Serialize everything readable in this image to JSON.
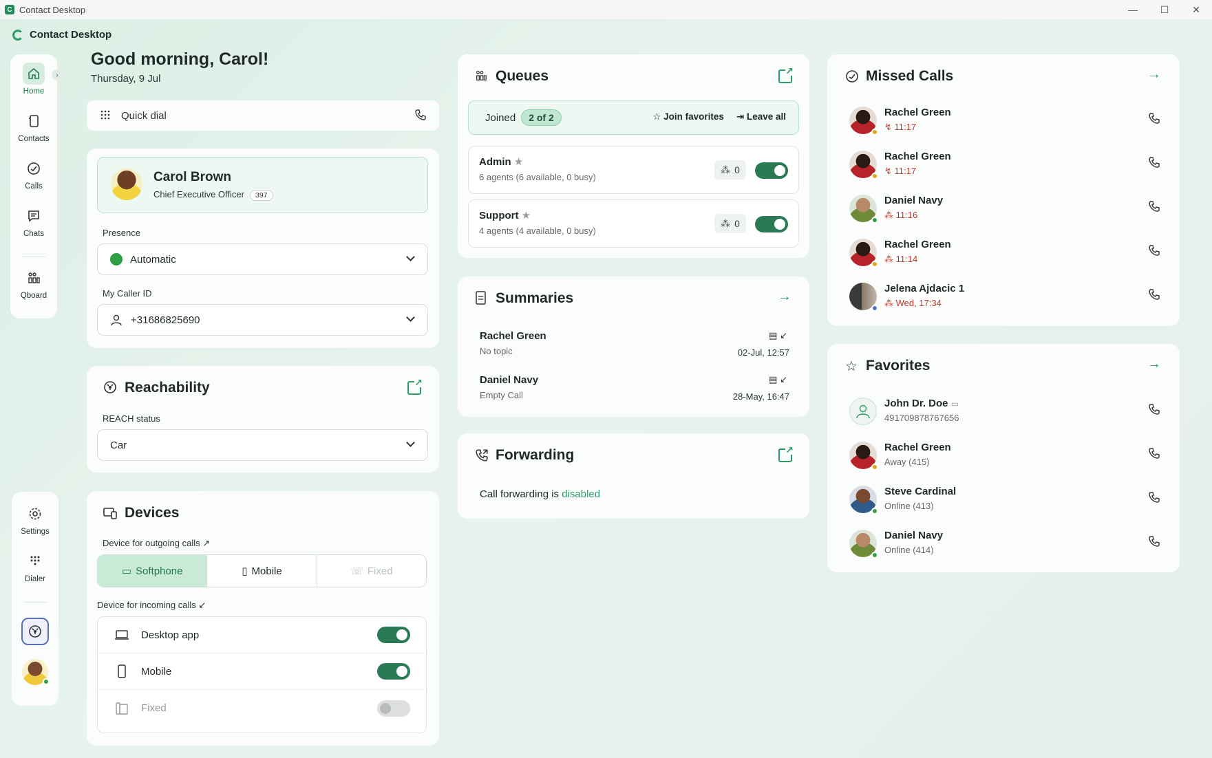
{
  "window": {
    "title": "Contact Desktop"
  },
  "app": {
    "name": "Contact Desktop"
  },
  "nav": {
    "items": [
      {
        "label": "Home",
        "icon": "home-icon",
        "active": true
      },
      {
        "label": "Contacts",
        "icon": "contacts-icon"
      },
      {
        "label": "Calls",
        "icon": "calls-icon"
      },
      {
        "label": "Chats",
        "icon": "chats-icon"
      },
      {
        "label": "Qboard",
        "icon": "qboard-icon"
      }
    ],
    "bottom": [
      {
        "label": "Settings",
        "icon": "gear-icon"
      },
      {
        "label": "Dialer",
        "icon": "dialpad-icon"
      }
    ]
  },
  "greeting": {
    "title": "Good morning, Carol!",
    "date": "Thursday, 9 Jul"
  },
  "quickdial": {
    "placeholder": "Quick dial"
  },
  "profile": {
    "name": "Carol Brown",
    "role": "Chief Executive Officer",
    "extension": "397",
    "presence_label": "Presence",
    "presence_value": "Automatic",
    "callerid_label": "My Caller ID",
    "callerid_value": "+31686825690"
  },
  "reachability": {
    "title": "Reachability",
    "status_label": "REACH status",
    "status_value": "Car"
  },
  "devices": {
    "title": "Devices",
    "outgoing_label": "Device for outgoing calls ↗",
    "outgoing_options": [
      "Softphone",
      "Mobile",
      "Fixed"
    ],
    "incoming_label": "Device for incoming calls ↙",
    "incoming": [
      {
        "label": "Desktop app",
        "enabled": true
      },
      {
        "label": "Mobile",
        "enabled": true
      },
      {
        "label": "Fixed",
        "enabled": false
      }
    ]
  },
  "queues": {
    "title": "Queues",
    "joined_label": "Joined",
    "joined_count": "2 of 2",
    "join_favorites": "Join favorites",
    "leave_all": "Leave all",
    "items": [
      {
        "name": "Admin",
        "sub": "6 agents (6 available, 0 busy)",
        "count": "0",
        "enabled": true
      },
      {
        "name": "Support",
        "sub": "4 agents (4 available, 0 busy)",
        "count": "0",
        "enabled": true
      }
    ]
  },
  "summaries": {
    "title": "Summaries",
    "items": [
      {
        "name": "Rachel Green",
        "topic": "No topic",
        "date": "02-Jul, 12:57"
      },
      {
        "name": "Daniel Navy",
        "topic": "Empty Call",
        "date": "28-May, 16:47"
      }
    ]
  },
  "forwarding": {
    "title": "Forwarding",
    "text": "Call forwarding is",
    "status": "disabled"
  },
  "missed": {
    "title": "Missed Calls",
    "items": [
      {
        "name": "Rachel Green",
        "time": "11:17",
        "avatar": "rachel",
        "presence": "orange"
      },
      {
        "name": "Rachel Green",
        "time": "11:17",
        "avatar": "rachel",
        "presence": "orange"
      },
      {
        "name": "Daniel Navy",
        "time": "11:16",
        "avatar": "daniel",
        "presence": "green"
      },
      {
        "name": "Rachel Green",
        "time": "11:14",
        "avatar": "rachel",
        "presence": "orange"
      },
      {
        "name": "Jelena Ajdacic 1",
        "time": "Wed, 17:34",
        "avatar": "jelena",
        "presence": "blue"
      }
    ]
  },
  "favorites": {
    "title": "Favorites",
    "items": [
      {
        "name": "John Dr. Doe",
        "sub": "491709878767656",
        "avatar": "john"
      },
      {
        "name": "Rachel Green",
        "sub": "Away (415)",
        "avatar": "rachel",
        "presence": "orange"
      },
      {
        "name": "Steve Cardinal",
        "sub": "Online (413)",
        "avatar": "steve",
        "presence": "green"
      },
      {
        "name": "Daniel Navy",
        "sub": "Online (414)",
        "avatar": "daniel",
        "presence": "green"
      }
    ]
  },
  "colors": {
    "accent": "#2e9b6a",
    "toggle_on": "#2a7a55",
    "missed": "#c0392b"
  }
}
